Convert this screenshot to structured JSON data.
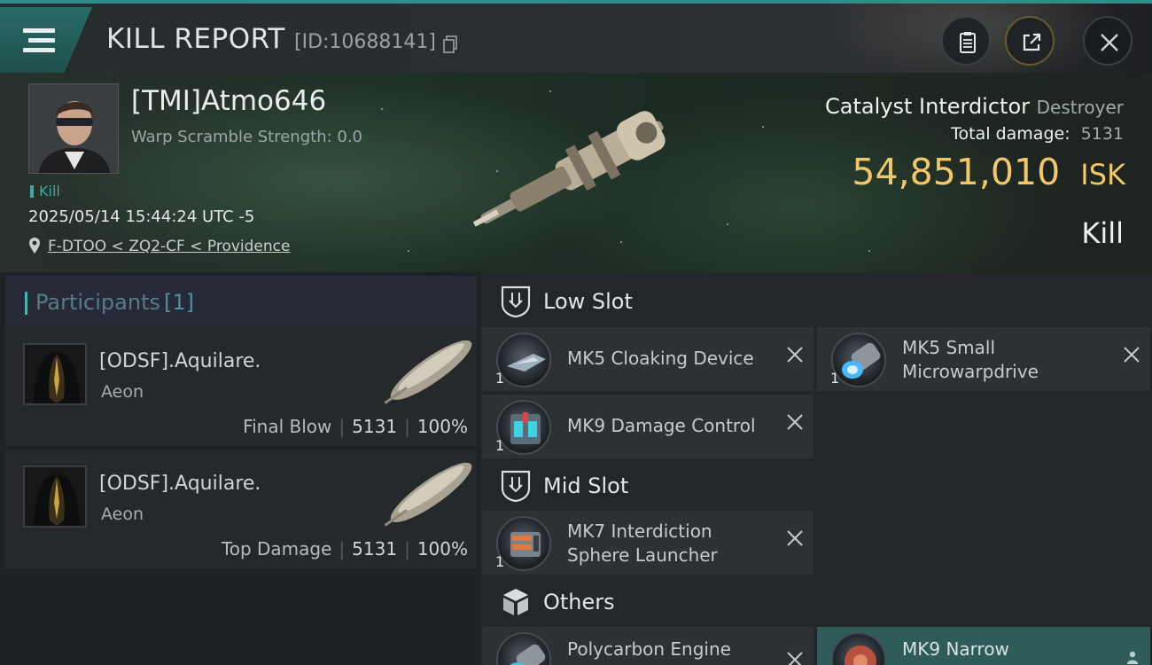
{
  "header": {
    "title": "KILL REPORT",
    "report_id": "[ID:10688141]",
    "icons": [
      "menu-icon",
      "copy-icon",
      "clipboard-icon",
      "share-icon",
      "close-icon"
    ]
  },
  "victim": {
    "name": "[TMI]Atmo646",
    "warp_scramble": "Warp Scramble Strength: 0.0",
    "tag": "Kill",
    "timestamp": "2025/05/14 15:44:24 UTC -5",
    "location": "F-DTOO < ZQ2-CF < Providence"
  },
  "ship": {
    "name": "Catalyst Interdictor",
    "class": "Destroyer",
    "total_damage_label": "Total damage:",
    "total_damage_value": "5131",
    "isk_amount": "54,851,010",
    "isk_unit": "ISK",
    "result": "Kill"
  },
  "participants": {
    "label": "Participants",
    "count": "[1]",
    "items": [
      {
        "name": "[ODSF].Aquilare.",
        "ship": "Aeon",
        "role": "Final Blow",
        "damage": "5131",
        "percent": "100%"
      },
      {
        "name": "[ODSF].Aquilare.",
        "ship": "Aeon",
        "role": "Top Damage",
        "damage": "5131",
        "percent": "100%"
      }
    ]
  },
  "fittings": {
    "low_slot": {
      "label": "Low Slot",
      "items": [
        {
          "qty": "1",
          "line1": "MK5 Cloaking Device",
          "line2": ""
        },
        {
          "qty": "1",
          "line1": "MK5 Small",
          "line2": "Microwarpdrive"
        },
        {
          "qty": "1",
          "line1": "MK9 Damage Control",
          "line2": ""
        }
      ]
    },
    "mid_slot": {
      "label": "Mid Slot",
      "items": [
        {
          "qty": "1",
          "line1": "MK7 Interdiction",
          "line2": "Sphere Launcher"
        }
      ]
    },
    "others": {
      "label": "Others",
      "items": [
        {
          "qty": "",
          "line1": "Polycarbon Engine",
          "line2": ""
        },
        {
          "qty": "",
          "line1": "MK9 Narrow",
          "line2": ""
        }
      ]
    }
  },
  "colors": {
    "accent": "#2e8f8a",
    "isk": "#f2c66a",
    "kill_tag": "#3fa79b"
  }
}
